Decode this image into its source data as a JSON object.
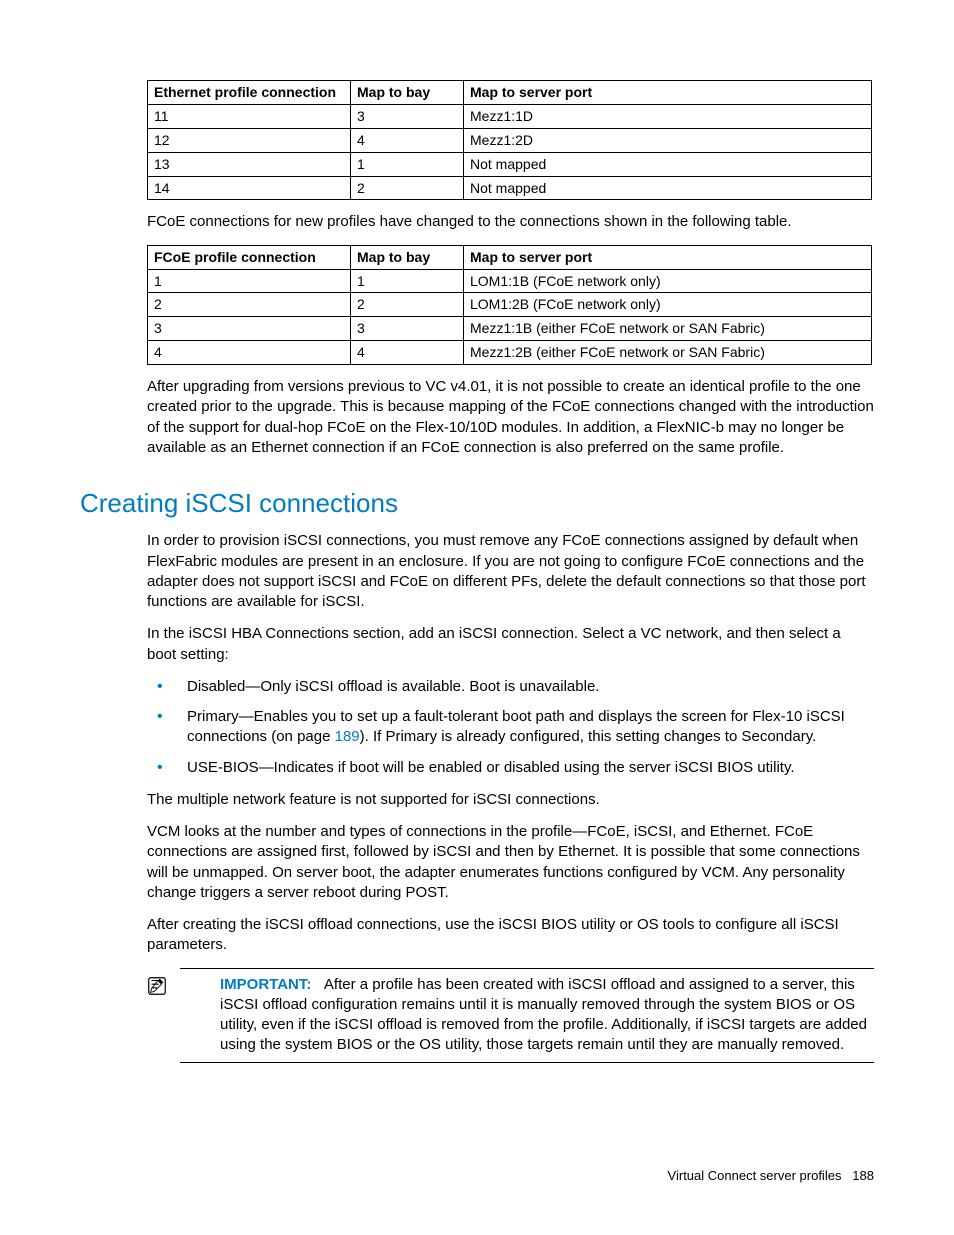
{
  "table1": {
    "headers": [
      "Ethernet profile connection",
      "Map to bay",
      "Map to server port"
    ],
    "rows": [
      [
        "11",
        "3",
        "Mezz1:1D"
      ],
      [
        "12",
        "4",
        "Mezz1:2D"
      ],
      [
        "13",
        "1",
        "Not mapped"
      ],
      [
        "14",
        "2",
        "Not mapped"
      ]
    ]
  },
  "para_between_tables": "FCoE connections for new profiles have changed to the connections shown in the following table.",
  "table2": {
    "headers": [
      "FCoE profile connection",
      "Map to bay",
      "Map to server port"
    ],
    "rows": [
      [
        "1",
        "1",
        "LOM1:1B (FCoE network only)"
      ],
      [
        "2",
        "2",
        "LOM1:2B (FCoE network only)"
      ],
      [
        "3",
        "3",
        "Mezz1:1B (either FCoE network or SAN Fabric)"
      ],
      [
        "4",
        "4",
        "Mezz1:2B (either FCoE network or SAN Fabric)"
      ]
    ]
  },
  "para_after_table2": "After upgrading from versions previous to VC v4.01, it is not possible to create an identical profile to the one created prior to the upgrade. This is because mapping of the FCoE connections changed with the introduction of the support for dual-hop FCoE on the Flex-10/10D modules. In addition, a FlexNIC-b may no longer be available as an Ethernet connection if an FCoE connection is also preferred on the same profile.",
  "section_heading": "Creating iSCSI connections",
  "para_s1": "In order to provision iSCSI connections, you must remove any FCoE connections assigned by default when FlexFabric modules are present in an enclosure. If you are not going to configure FCoE connections and the adapter does not support iSCSI and FCoE on different PFs, delete the default connections so that those port functions are available for iSCSI.",
  "para_s2": "In the iSCSI HBA Connections section, add an iSCSI connection. Select a VC network, and then select a boot setting:",
  "bullets": {
    "b1": "Disabled—Only iSCSI offload is available. Boot is unavailable.",
    "b2_pre": "Primary—Enables you to set up a fault-tolerant boot path and displays the screen for Flex-10 iSCSI connections (on page ",
    "b2_link": "189",
    "b2_post": "). If Primary is already configured, this setting changes to Secondary.",
    "b3": "USE-BIOS—Indicates if boot will be enabled or disabled using the server iSCSI BIOS utility."
  },
  "para_s3": "The multiple network feature is not supported for iSCSI connections.",
  "para_s4": "VCM looks at the number and types of connections in the profile—FCoE, iSCSI, and Ethernet. FCoE connections are assigned first, followed by iSCSI and then by Ethernet. It is possible that some connections will be unmapped. On server boot, the adapter enumerates functions configured by VCM. Any personality change triggers a server reboot during POST.",
  "para_s5": "After creating the iSCSI offload connections, use the iSCSI BIOS utility or OS tools to configure all iSCSI parameters.",
  "important": {
    "label": "IMPORTANT:",
    "text": "After a profile has been created with iSCSI offload and assigned to a server, this iSCSI offload configuration remains until it is manually removed through the system BIOS or OS utility, even if the iSCSI offload is removed from the profile. Additionally, if iSCSI targets are added using the system BIOS or the OS utility, those targets remain until they are manually removed."
  },
  "footer": {
    "section": "Virtual Connect server profiles",
    "page": "188"
  }
}
